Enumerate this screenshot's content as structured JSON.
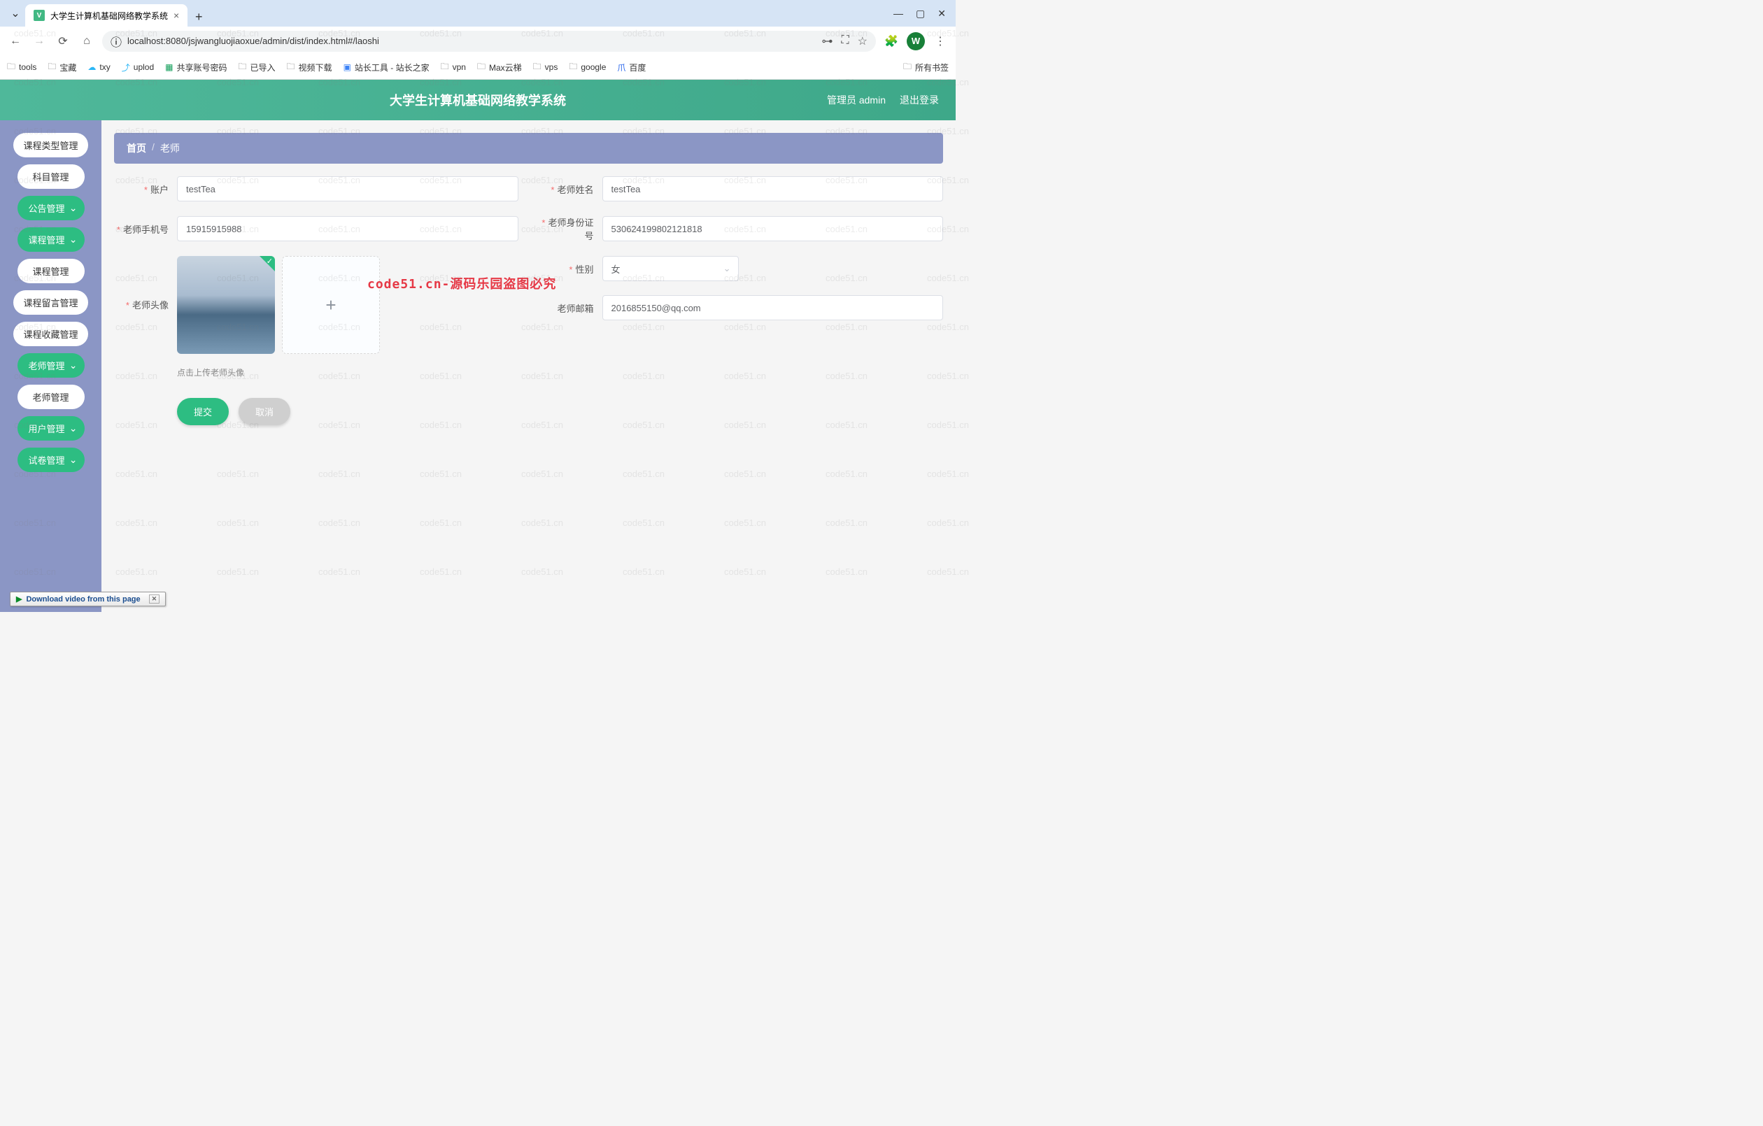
{
  "browser": {
    "tab_title": "大学生计算机基础网络教学系统",
    "url": "localhost:8080/jsjwangluojiaoxue/admin/dist/index.html#/laoshi",
    "new_tab": "+",
    "profile_letter": "W",
    "window": {
      "min": "—",
      "max": "▢",
      "close": "✕"
    }
  },
  "bookmarks": {
    "items": [
      "tools",
      "宝藏",
      "txy",
      "uplod",
      "共享账号密码",
      "已导入",
      "视频下载",
      "站长工具 - 站长之家",
      "vpn",
      "Max云梯",
      "vps",
      "google",
      "百度"
    ],
    "all": "所有书签"
  },
  "app": {
    "title": "大学生计算机基础网络教学系统",
    "admin_label": "管理员 admin",
    "logout": "退出登录"
  },
  "sidebar": {
    "items": [
      {
        "label": "课程类型管理",
        "type": "white"
      },
      {
        "label": "科目管理",
        "type": "white"
      },
      {
        "label": "公告管理",
        "type": "green"
      },
      {
        "label": "课程管理",
        "type": "green"
      },
      {
        "label": "课程管理",
        "type": "white"
      },
      {
        "label": "课程留言管理",
        "type": "white"
      },
      {
        "label": "课程收藏管理",
        "type": "white"
      },
      {
        "label": "老师管理",
        "type": "green"
      },
      {
        "label": "老师管理",
        "type": "white"
      },
      {
        "label": "用户管理",
        "type": "green"
      },
      {
        "label": "试卷管理",
        "type": "green"
      }
    ]
  },
  "breadcrumb": {
    "home": "首页",
    "sep": "/",
    "current": "老师"
  },
  "form": {
    "account": {
      "label": "账户",
      "value": "testTea"
    },
    "name": {
      "label": "老师姓名",
      "value": "testTea"
    },
    "phone": {
      "label": "老师手机号",
      "value": "15915915988"
    },
    "idcard": {
      "label": "老师身份证号",
      "value": "530624199802121818"
    },
    "avatar": {
      "label": "老师头像",
      "hint": "点击上传老师头像"
    },
    "gender": {
      "label": "性别",
      "value": "女"
    },
    "email": {
      "label": "老师邮箱",
      "value": "2016855150@qq.com"
    },
    "submit": "提交",
    "cancel": "取消"
  },
  "watermark_red": "code51.cn-源码乐园盗图必究",
  "watermark_grey": "code51.cn",
  "download_banner": "Download video from this page"
}
